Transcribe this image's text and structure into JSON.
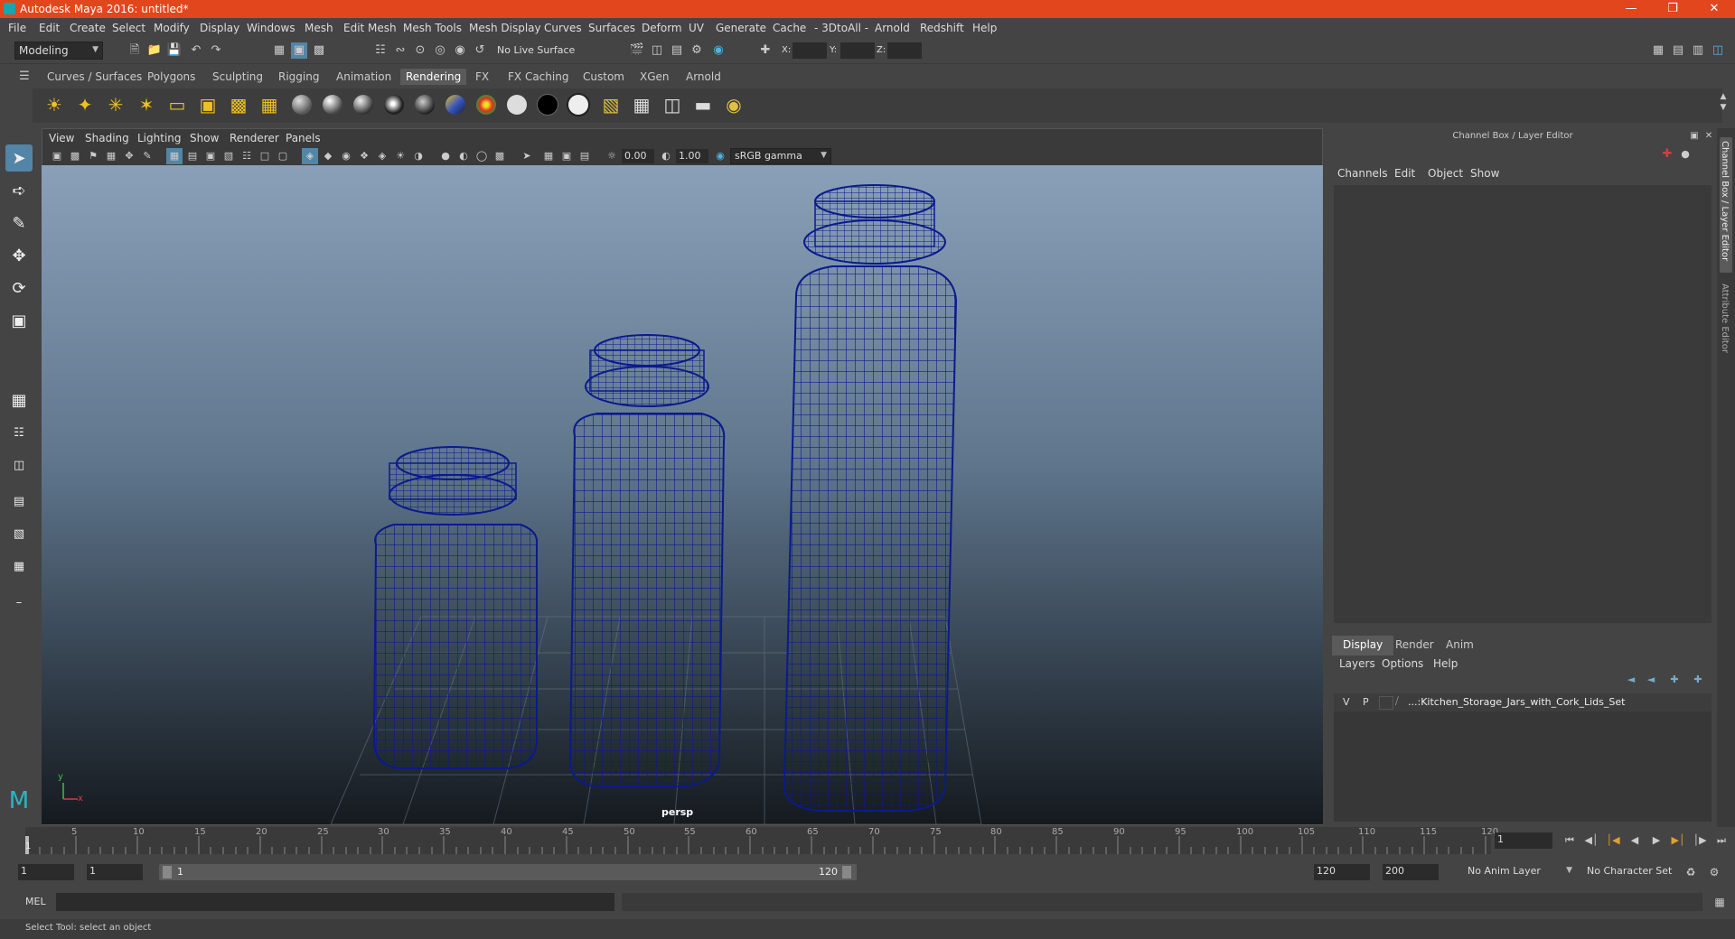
{
  "window": {
    "title": "Autodesk Maya 2016: untitled*"
  },
  "menus": [
    "File",
    "Edit",
    "Create",
    "Select",
    "Modify",
    "Display",
    "Windows",
    "Mesh",
    "Edit Mesh",
    "Mesh Tools",
    "Mesh Display",
    "Curves",
    "Surfaces",
    "Deform",
    "UV",
    "Generate",
    "Cache",
    "- 3DtoAll -",
    "Arnold",
    "Redshift",
    "Help"
  ],
  "status": {
    "mode": "Modeling",
    "live_surface": "No Live Surface",
    "x_label": "X:",
    "y_label": "Y:",
    "z_label": "Z:"
  },
  "shelf_tabs": [
    "Curves / Surfaces",
    "Polygons",
    "Sculpting",
    "Rigging",
    "Animation",
    "Rendering",
    "FX",
    "FX Caching",
    "Custom",
    "XGen",
    "Arnold"
  ],
  "shelf_active": "Rendering",
  "viewport": {
    "menus": [
      "View",
      "Shading",
      "Lighting",
      "Show",
      "Renderer",
      "Panels"
    ],
    "exposure": "0.00",
    "gamma": "1.00",
    "color_space": "sRGB gamma",
    "camera_label": "persp",
    "axis_y": "y",
    "axis_x": "x"
  },
  "channel_box": {
    "title": "Channel Box / Layer Editor",
    "menus": [
      "Channels",
      "Edit",
      "Object",
      "Show"
    ]
  },
  "layer_editor": {
    "tabs": [
      "Display",
      "Render",
      "Anim"
    ],
    "active_tab": "Display",
    "menus": [
      "Layers",
      "Options",
      "Help"
    ],
    "layers": [
      {
        "v": "V",
        "p": "P",
        "name": "...:Kitchen_Storage_Jars_with_Cork_Lids_Set"
      }
    ]
  },
  "side_tabs": [
    "Channel Box / Layer Editor",
    "Attribute Editor"
  ],
  "timeline": {
    "ticks": [
      "5",
      "10",
      "15",
      "20",
      "25",
      "30",
      "35",
      "40",
      "45",
      "50",
      "55",
      "60",
      "65",
      "70",
      "75",
      "80",
      "85",
      "90",
      "95",
      "100",
      "105",
      "110",
      "115",
      "120"
    ],
    "first_tick": "1",
    "current_frame": "1"
  },
  "range": {
    "start": "1",
    "playback_start": "1",
    "slider_start": "1",
    "slider_end": "120",
    "playback_end": "120",
    "end": "200",
    "anim_layer": "No Anim Layer",
    "character_set": "No Character Set"
  },
  "mel": {
    "label": "MEL"
  },
  "help_line": "Select Tool: select an object",
  "colors": {
    "title_bar": "#e2461d",
    "wireframe": "#0b1a8c",
    "active_tool": "#5285a6"
  }
}
